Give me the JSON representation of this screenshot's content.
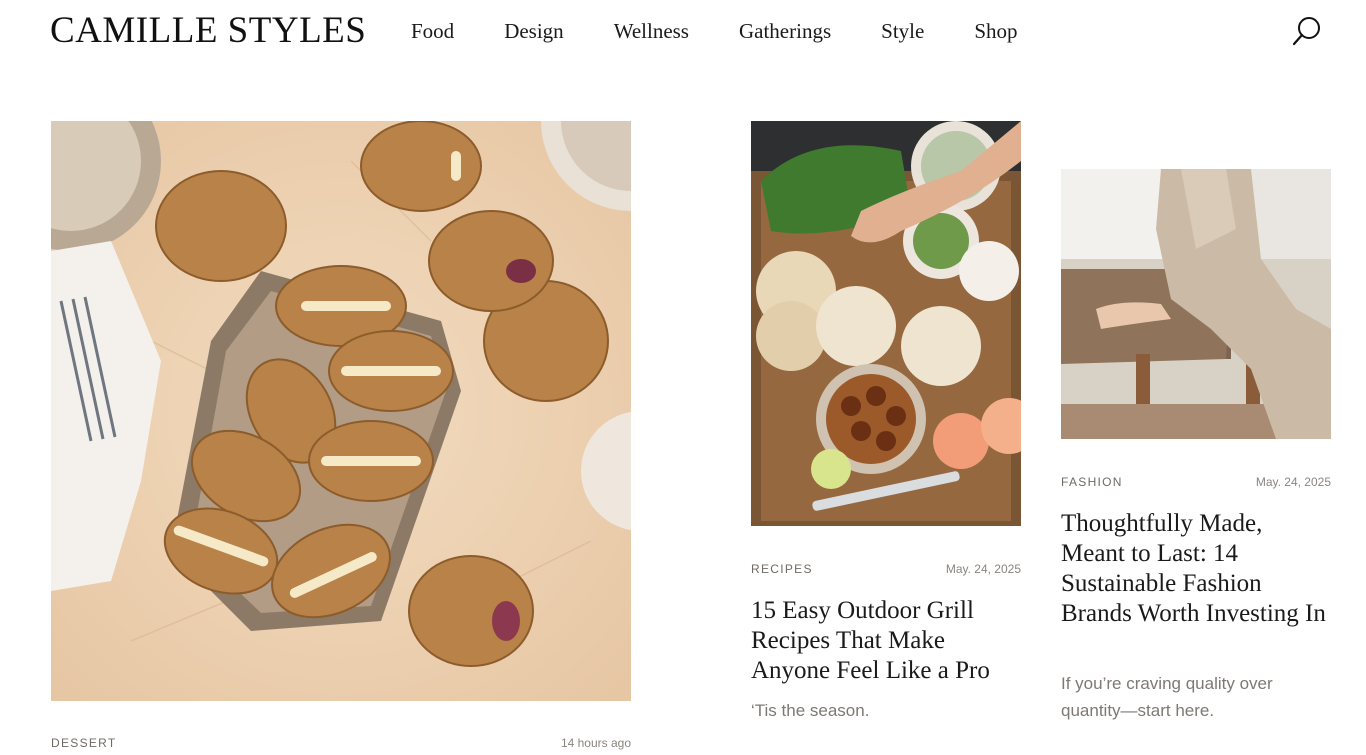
{
  "site": {
    "logo": "CAMILLE STYLES",
    "nav": [
      "Food",
      "Design",
      "Wellness",
      "Gatherings",
      "Style",
      "Shop"
    ],
    "search_icon": "search-icon"
  },
  "cards": [
    {
      "image": "sandwich-cookies-photo",
      "category": "DESSERT",
      "date": "14 hours ago"
    },
    {
      "image": "outdoor-grill-spread-photo",
      "category": "RECIPES",
      "date": "May. 24, 2025",
      "title": "15 Easy Outdoor Grill Recipes That Make Anyone Feel Like a Pro",
      "excerpt": "‘Tis the season."
    },
    {
      "image": "woman-on-woven-bench-photo",
      "category": "FASHION",
      "date": "May. 24, 2025",
      "title": "Thoughtfully Made, Meant to Last: 14 Sustainable Fashion Brands Worth Investing In",
      "excerpt": "If you’re craving quality over quantity—start here."
    }
  ]
}
